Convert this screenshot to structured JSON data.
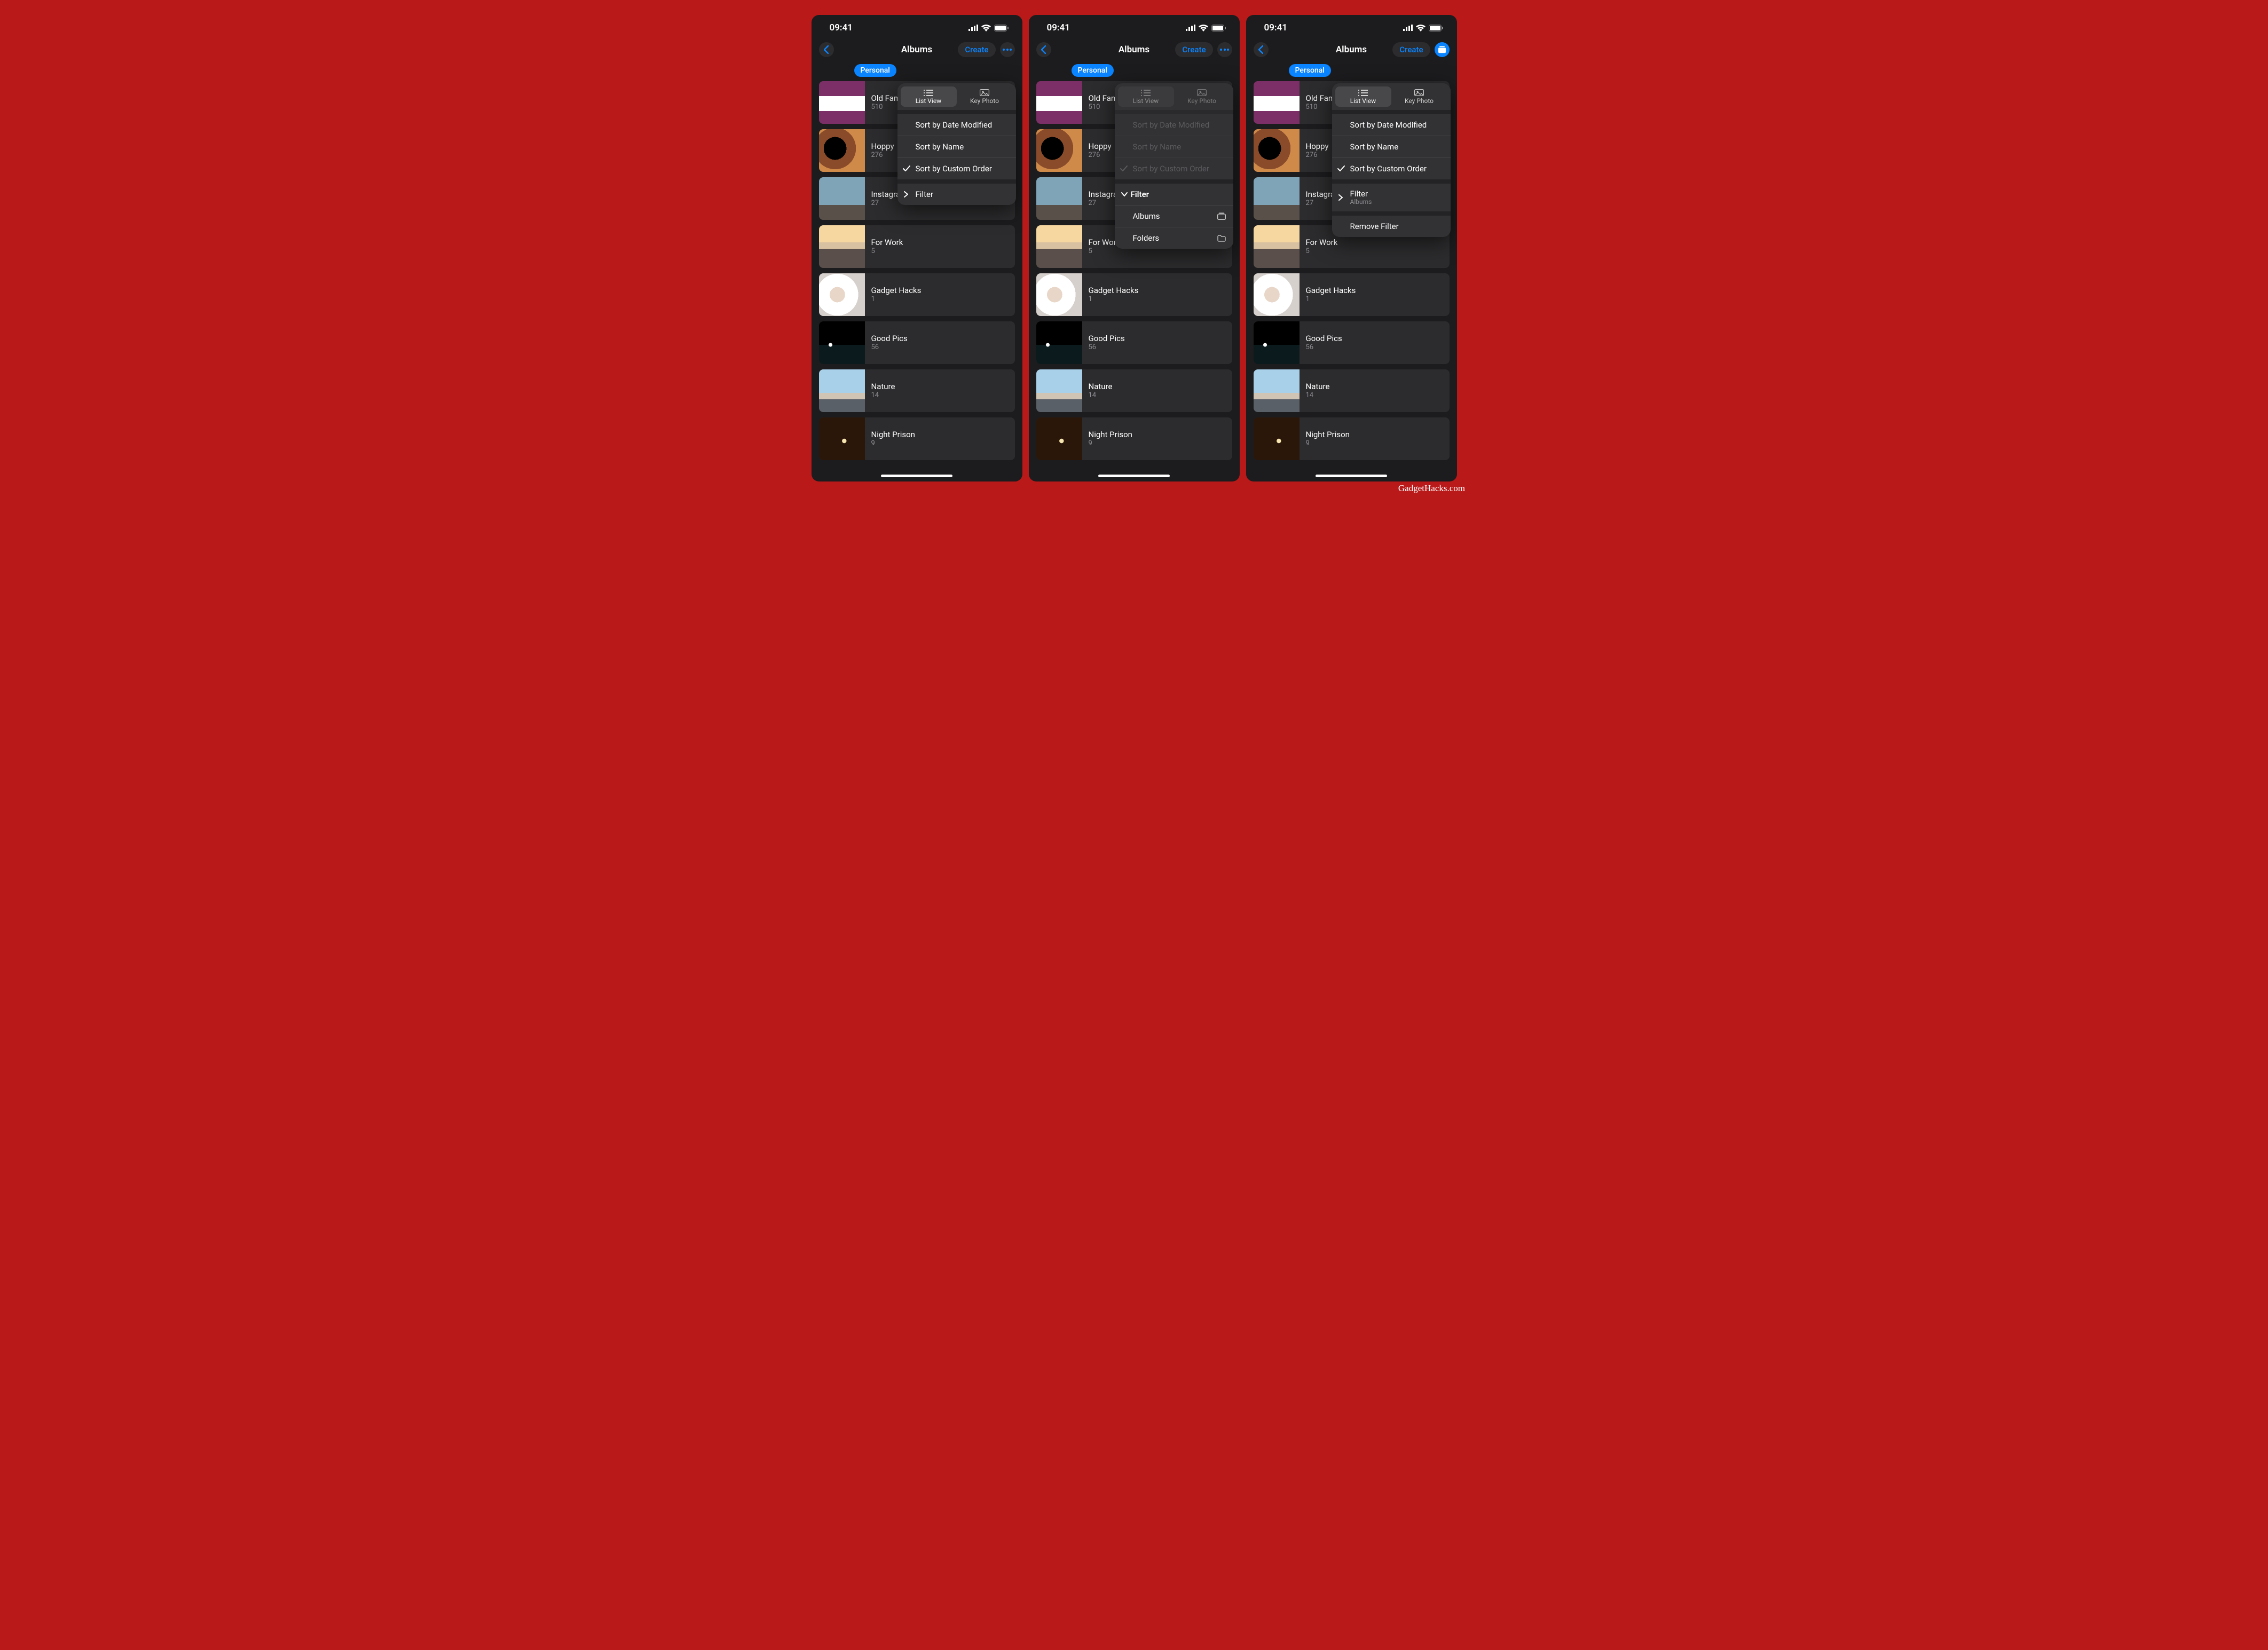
{
  "watermark": "GadgetHacks.com",
  "status": {
    "time": "09:41"
  },
  "header": {
    "title": "Albums",
    "create": "Create"
  },
  "tabs": {
    "personal": "Personal"
  },
  "view_toggle": {
    "list": "List View",
    "key": "Key Photo"
  },
  "sort": {
    "date": "Sort by Date Modified",
    "name": "Sort by Name",
    "custom": "Sort by Custom Order"
  },
  "filter": {
    "label": "Filter",
    "albums": "Albums",
    "folders": "Folders",
    "remove": "Remove Filter"
  },
  "albums": [
    {
      "name": "Old Family Photos",
      "name_trunc": "Old Family F",
      "count": "510"
    },
    {
      "name": "Hoppy",
      "count": "276"
    },
    {
      "name": "Instagram",
      "count": "27"
    },
    {
      "name": "For Work",
      "count": "5"
    },
    {
      "name": "Gadget Hacks",
      "count": "1"
    },
    {
      "name": "Good Pics",
      "count": "56"
    },
    {
      "name": "Nature",
      "count": "14"
    },
    {
      "name": "Night Prison",
      "count": "9"
    }
  ]
}
